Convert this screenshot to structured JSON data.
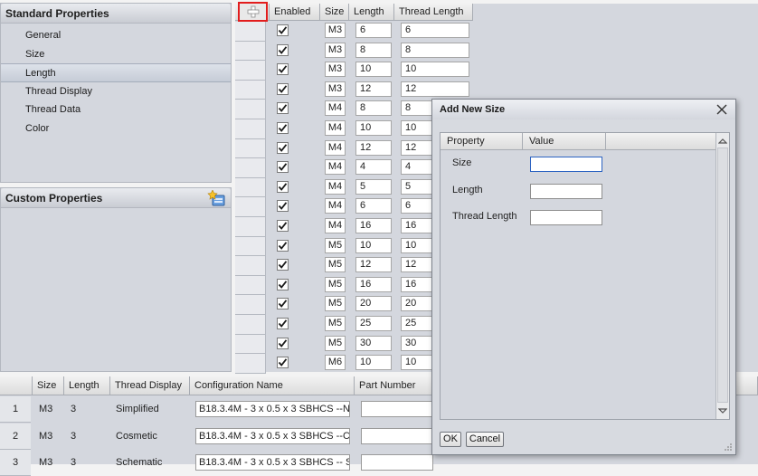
{
  "standard_panel": {
    "title": "Standard Properties",
    "items": [
      {
        "label": "General"
      },
      {
        "label": "Size"
      },
      {
        "label": "Length",
        "selected": true
      },
      {
        "label": "Thread Display"
      },
      {
        "label": "Thread Data"
      },
      {
        "label": "Color"
      }
    ]
  },
  "custom_panel": {
    "title": "Custom Properties",
    "add_icon": "add-property-icon"
  },
  "sizes_grid": {
    "add_icon": "add-row-icon",
    "columns": [
      "Enabled",
      "Size",
      "Length",
      "Thread Length"
    ],
    "rows": [
      {
        "enabled": true,
        "size": "M3",
        "length": "6",
        "thread_length": "6"
      },
      {
        "enabled": true,
        "size": "M3",
        "length": "8",
        "thread_length": "8"
      },
      {
        "enabled": true,
        "size": "M3",
        "length": "10",
        "thread_length": "10"
      },
      {
        "enabled": true,
        "size": "M3",
        "length": "12",
        "thread_length": "12"
      },
      {
        "enabled": true,
        "size": "M4",
        "length": "8",
        "thread_length": "8"
      },
      {
        "enabled": true,
        "size": "M4",
        "length": "10",
        "thread_length": "10"
      },
      {
        "enabled": true,
        "size": "M4",
        "length": "12",
        "thread_length": "12"
      },
      {
        "enabled": true,
        "size": "M4",
        "length": "4",
        "thread_length": "4"
      },
      {
        "enabled": true,
        "size": "M4",
        "length": "5",
        "thread_length": "5"
      },
      {
        "enabled": true,
        "size": "M4",
        "length": "6",
        "thread_length": "6"
      },
      {
        "enabled": true,
        "size": "M4",
        "length": "16",
        "thread_length": "16"
      },
      {
        "enabled": true,
        "size": "M5",
        "length": "10",
        "thread_length": "10"
      },
      {
        "enabled": true,
        "size": "M5",
        "length": "12",
        "thread_length": "12"
      },
      {
        "enabled": true,
        "size": "M5",
        "length": "16",
        "thread_length": "16"
      },
      {
        "enabled": true,
        "size": "M5",
        "length": "20",
        "thread_length": "20"
      },
      {
        "enabled": true,
        "size": "M5",
        "length": "25",
        "thread_length": "25"
      },
      {
        "enabled": true,
        "size": "M5",
        "length": "30",
        "thread_length": "30"
      },
      {
        "enabled": true,
        "size": "M6",
        "length": "10",
        "thread_length": "10"
      }
    ]
  },
  "config_table": {
    "columns": [
      "Size",
      "Length",
      "Thread Display",
      "Configuration Name",
      "Part Number"
    ],
    "rows": [
      {
        "num": "1",
        "size": "M3",
        "length": "3",
        "thread_display": "Simplified",
        "config_name": "B18.3.4M - 3 x 0.5 x 3 SBHCS --N",
        "part_number": ""
      },
      {
        "num": "2",
        "size": "M3",
        "length": "3",
        "thread_display": "Cosmetic",
        "config_name": "B18.3.4M - 3 x 0.5 x 3 SBHCS --C",
        "part_number": ""
      },
      {
        "num": "3",
        "size": "M3",
        "length": "3",
        "thread_display": "Schematic",
        "config_name": "B18.3.4M - 3 x 0.5 x 3 SBHCS -- S",
        "part_number": ""
      }
    ]
  },
  "dialog": {
    "title": "Add New Size",
    "columns": [
      "Property",
      "Value"
    ],
    "fields": [
      {
        "label": "Size",
        "value": ""
      },
      {
        "label": "Length",
        "value": ""
      },
      {
        "label": "Thread Length",
        "value": ""
      }
    ],
    "ok_label": "OK",
    "cancel_label": "Cancel"
  },
  "colors": {
    "panel_bg": "#d4d7de",
    "highlight_border": "#e21d1d",
    "focus_border": "#2c63c2"
  }
}
